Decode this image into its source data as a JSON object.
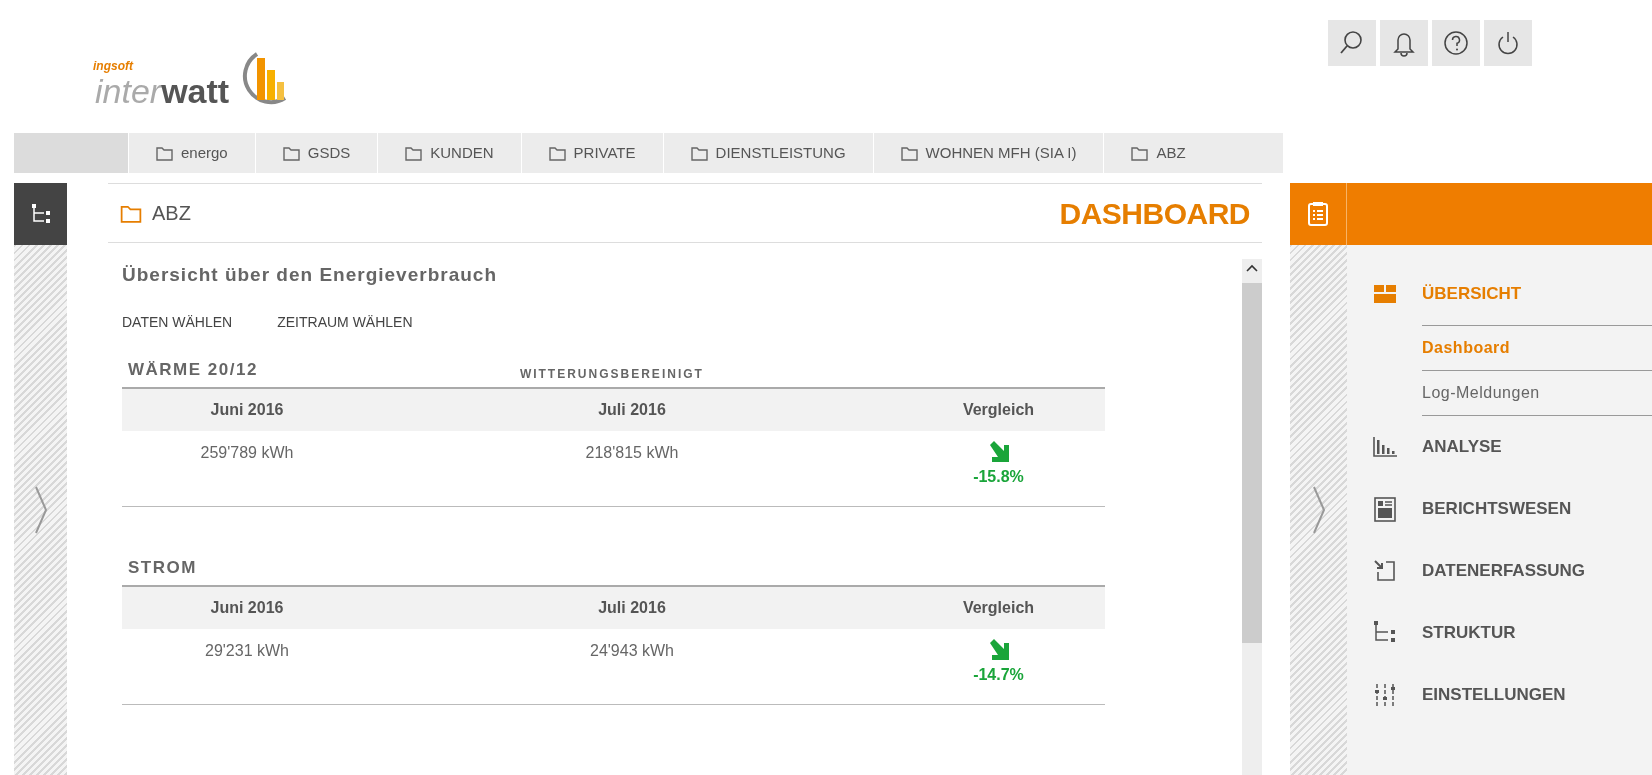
{
  "header": {
    "logo": {
      "brand_small": "ingsoft",
      "brand_light": "inter",
      "brand_bold": "watt"
    },
    "toolbar": [
      {
        "kind": "search"
      },
      {
        "kind": "notifications"
      },
      {
        "kind": "help"
      },
      {
        "kind": "power"
      }
    ]
  },
  "breadcrumbs": [
    {
      "label": "energo"
    },
    {
      "label": "GSDS"
    },
    {
      "label": "KUNDEN"
    },
    {
      "label": "PRIVATE"
    },
    {
      "label": "DIENSTLEISTUNG"
    },
    {
      "label": "WOHNEN MFH (SIA I)"
    },
    {
      "label": "ABZ"
    }
  ],
  "main": {
    "folder": "ABZ",
    "page_title": "DASHBOARD",
    "heading": "Übersicht über den Energieverbrauch",
    "actions": [
      "DATEN WÄHLEN",
      "ZEITRAUM WÄHLEN"
    ],
    "sections": [
      {
        "title": "WÄRME 20/12",
        "note": "WITTERUNGSBEREINIGT",
        "columns": [
          "Juni 2016",
          "Juli 2016",
          "Vergleich"
        ],
        "rows": [
          {
            "cells": [
              "259'789 kWh",
              "218'815 kWh"
            ],
            "kind": "decrease",
            "change": "-15.8%"
          }
        ]
      },
      {
        "title": "STROM",
        "columns": [
          "Juni 2016",
          "Juli 2016",
          "Vergleich"
        ],
        "rows": [
          {
            "cells": [
              "29'231 kWh",
              "24'943 kWh"
            ],
            "kind": "decrease",
            "change": "-14.7%"
          }
        ]
      }
    ]
  },
  "nav": {
    "items": [
      {
        "kind": "tiles",
        "label": "ÜBERSICHT",
        "selected": true,
        "children": [
          {
            "label": "Dashboard",
            "selected": true
          },
          {
            "label": "Log-Meldungen",
            "selected": false
          }
        ]
      },
      {
        "kind": "bars",
        "label": "ANALYSE",
        "selected": false
      },
      {
        "kind": "report",
        "label": "BERICHTSWESEN",
        "selected": false
      },
      {
        "kind": "import",
        "label": "DATENERFASSUNG",
        "selected": false
      },
      {
        "kind": "tree",
        "label": "STRUKTUR",
        "selected": false
      },
      {
        "kind": "sliders",
        "label": "EINSTELLUNGEN",
        "selected": false
      }
    ]
  }
}
